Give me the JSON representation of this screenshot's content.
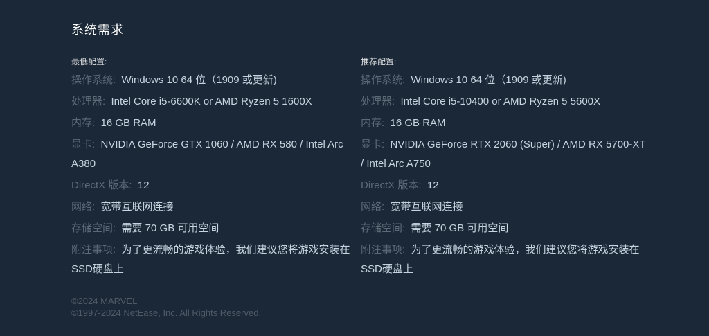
{
  "section": {
    "title": "系统需求"
  },
  "minimum": {
    "heading": "最低配置:",
    "rows": [
      {
        "label": "操作系统:",
        "value": "Windows 10 64 位（1909 或更新)"
      },
      {
        "label": "处理器:",
        "value": "Intel Core i5-6600K or AMD Ryzen 5 1600X"
      },
      {
        "label": "内存:",
        "value": "16 GB RAM"
      },
      {
        "label": "显卡:",
        "value": "NVIDIA GeForce GTX 1060 / AMD RX 580 / Intel Arc A380"
      },
      {
        "label": "DirectX 版本:",
        "value": "12"
      },
      {
        "label": "网络:",
        "value": "宽带互联网连接"
      },
      {
        "label": "存储空间:",
        "value": "需要 70 GB 可用空间"
      },
      {
        "label": "附注事项:",
        "value": "为了更流畅的游戏体验，我们建议您将游戏安装在SSD硬盘上"
      }
    ]
  },
  "recommended": {
    "heading": "推荐配置:",
    "rows": [
      {
        "label": "操作系统:",
        "value": "Windows 10 64 位（1909 或更新)"
      },
      {
        "label": "处理器:",
        "value": "Intel Core i5-10400 or AMD Ryzen 5 5600X"
      },
      {
        "label": "内存:",
        "value": "16 GB RAM"
      },
      {
        "label": "显卡:",
        "value": "NVIDIA GeForce RTX 2060 (Super) / AMD RX 5700-XT / Intel Arc A750"
      },
      {
        "label": "DirectX 版本:",
        "value": "12"
      },
      {
        "label": "网络:",
        "value": "宽带互联网连接"
      },
      {
        "label": "存储空间:",
        "value": "需要 70 GB 可用空间"
      },
      {
        "label": "附注事项:",
        "value": "为了更流畅的游戏体验，我们建议您将游戏安装在SSD硬盘上"
      }
    ]
  },
  "footer": {
    "line1": "©2024 MARVEL",
    "line2": "©1997-2024 NetEase, Inc. All Rights Reserved."
  },
  "colors": {
    "background": "#1b2838",
    "label": "#5c6a78",
    "value": "#c6d4df",
    "heading": "#ffffff"
  }
}
